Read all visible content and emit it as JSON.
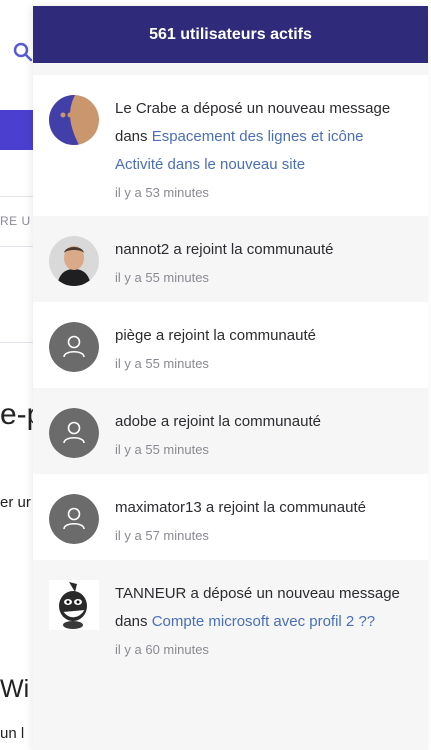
{
  "background_page": {
    "input_fragment": "RE U",
    "heading_fragment": "e-p",
    "text_fragment": "er ur",
    "heading2_fragment": "Wi",
    "text2_fragment": "un l"
  },
  "panel": {
    "title": "561 utilisateurs actifs",
    "items": [
      {
        "avatar": "crab-avatar-icon",
        "text": "Le Crabe a déposé un nouveau message dans ",
        "link": "Espacement des lignes et icône Activité dans le nouveau site",
        "time": "il y a 53 minutes"
      },
      {
        "avatar": "user-photo-avatar",
        "text": "nannot2 a rejoint la communauté",
        "link": "",
        "time": "il y a 55 minutes"
      },
      {
        "avatar": "default-user-icon",
        "text": "piège a rejoint la communauté",
        "link": "",
        "time": "il y a 55 minutes"
      },
      {
        "avatar": "default-user-icon",
        "text": "adobe a rejoint la communauté",
        "link": "",
        "time": "il y a 55 minutes"
      },
      {
        "avatar": "default-user-icon",
        "text": "maximator13 a rejoint la communauté",
        "link": "",
        "time": "il y a 57 minutes"
      },
      {
        "avatar": "cartoon-avatar-icon",
        "text": "TANNEUR a déposé un nouveau message dans ",
        "link": "Compte microsoft avec profil 2 ??",
        "time": "il y a 60 minutes"
      }
    ]
  },
  "colors": {
    "header_bg": "#2f2b7a",
    "link": "#4a6fb8",
    "accent": "#4b3fd0"
  }
}
